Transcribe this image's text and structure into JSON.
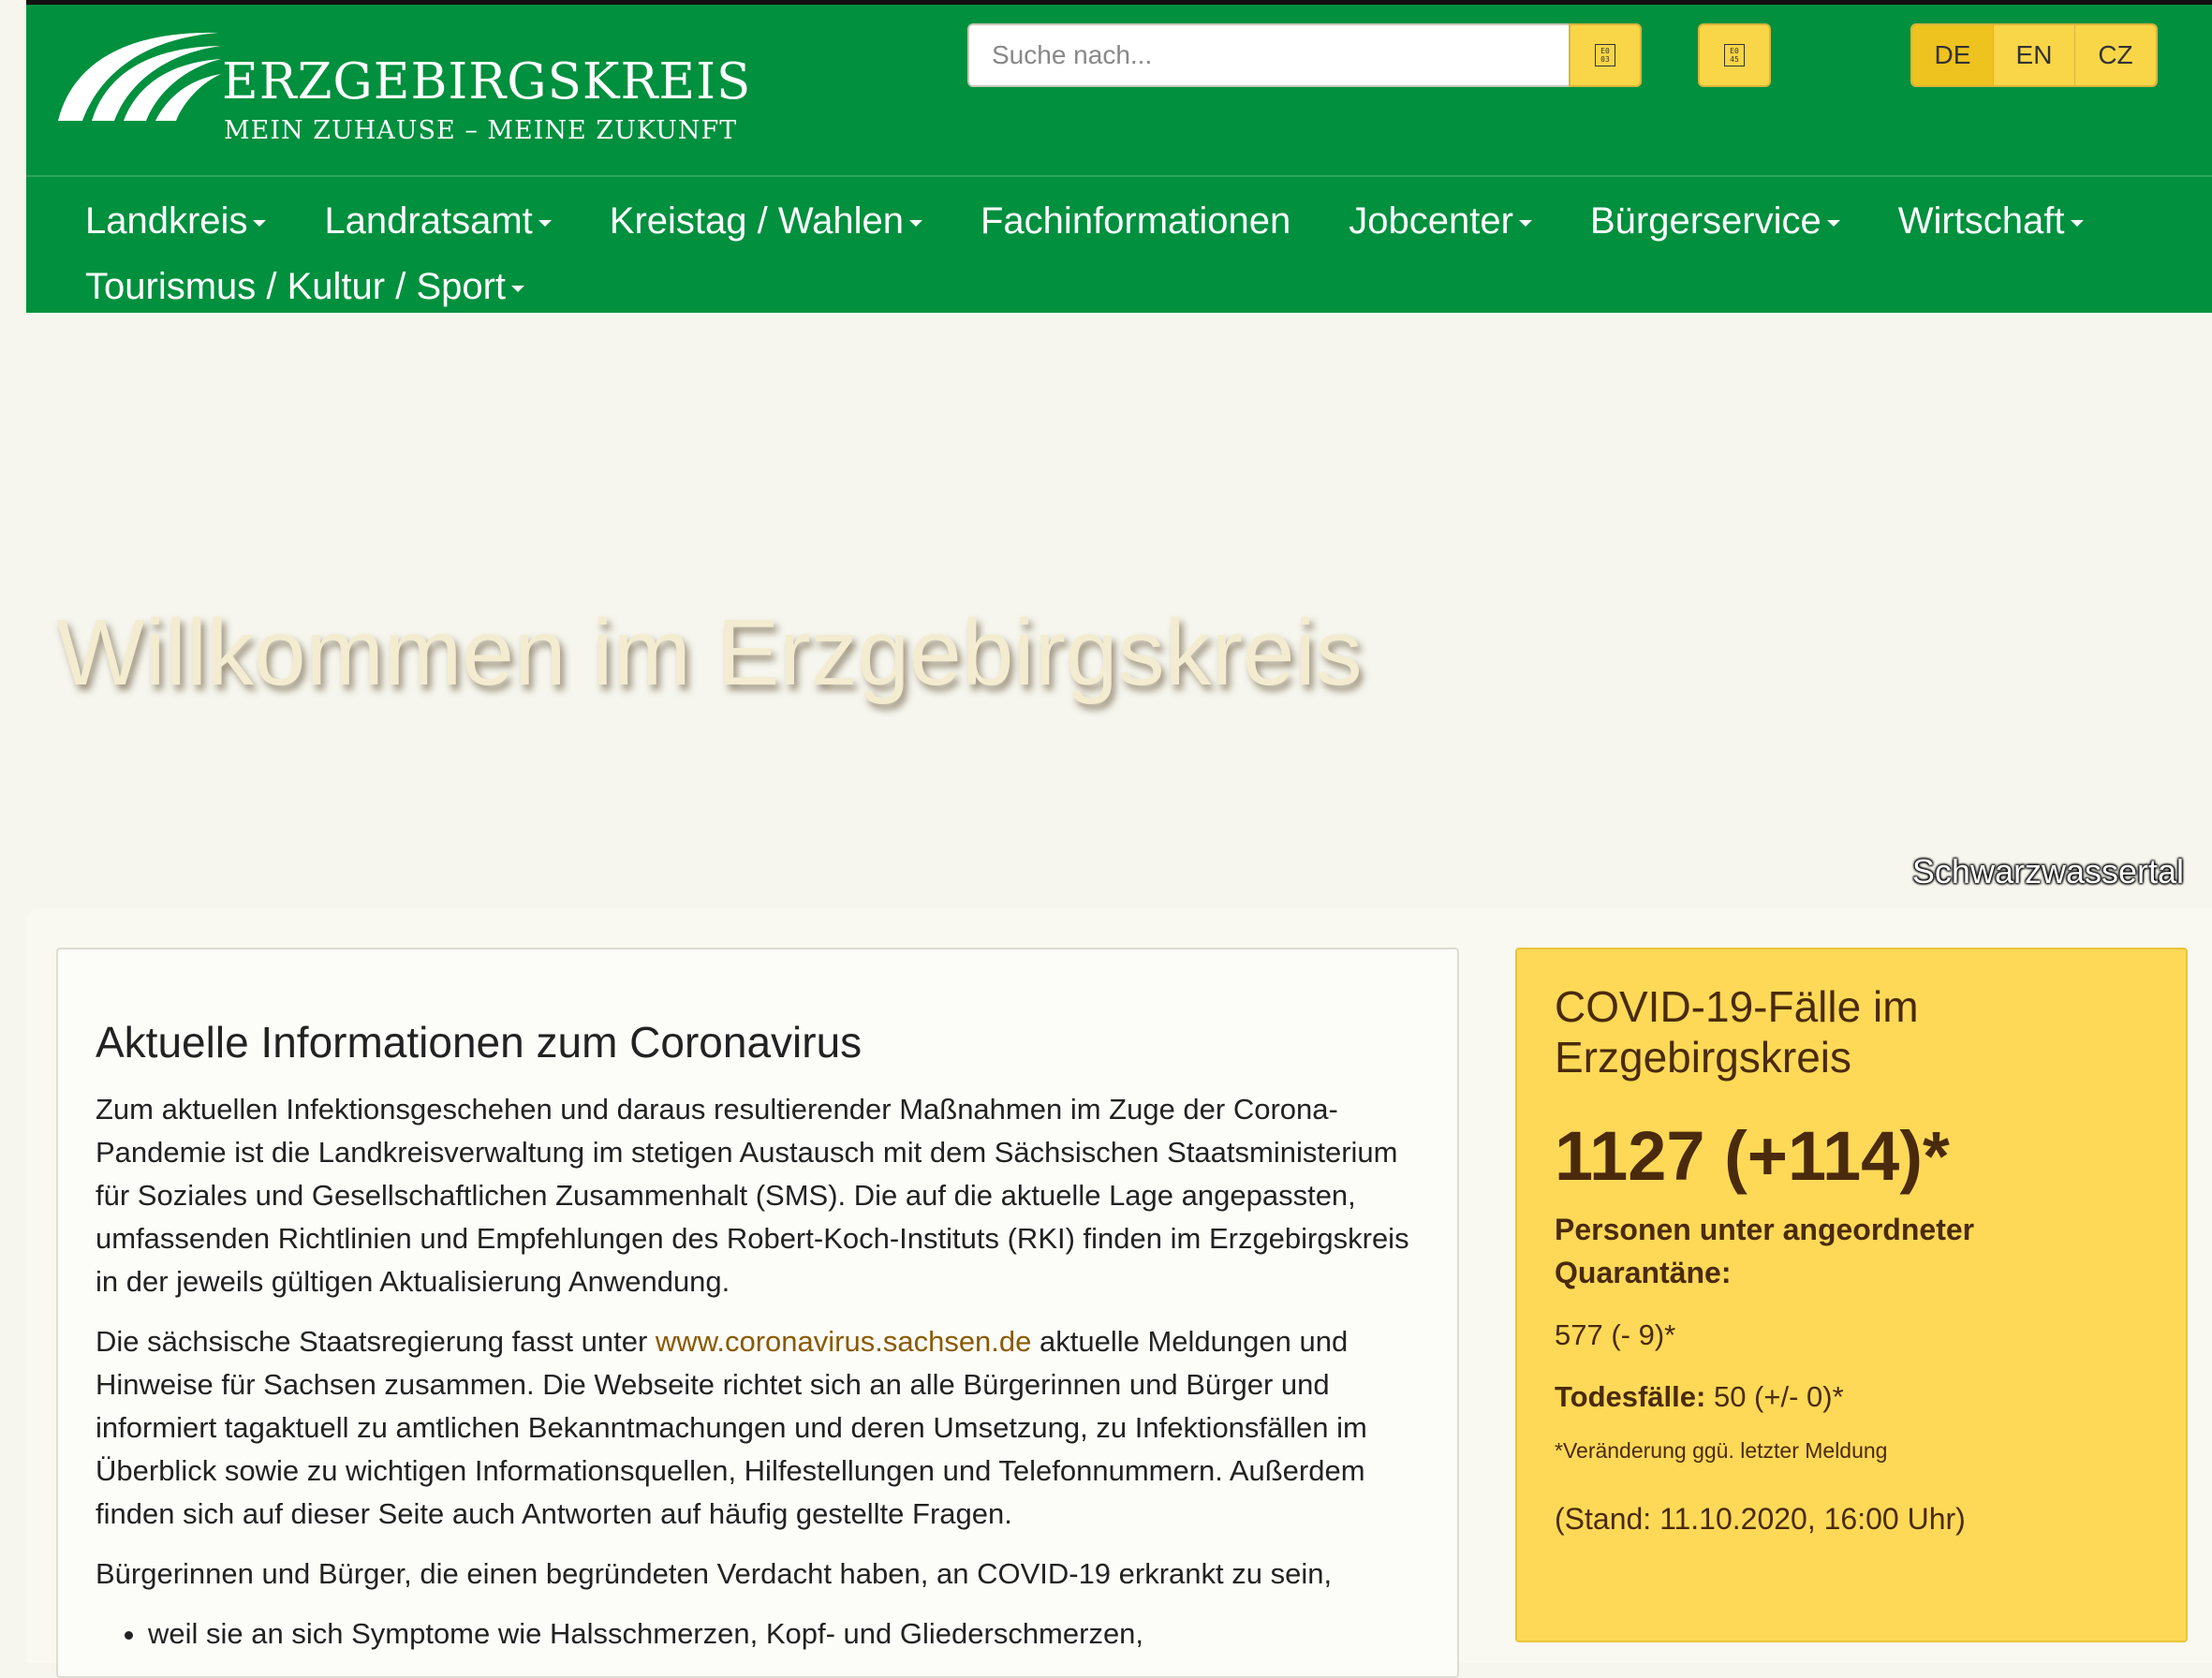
{
  "header": {
    "logo_title": "ERZGEBIRGSKREIS",
    "logo_subtitle": "MEIN ZUHAUSE – MEINE ZUKUNFT",
    "search": {
      "placeholder": "Suche nach..."
    },
    "search_button_glyph": "E0\n03",
    "extra_button_glyph": "E0\n45",
    "languages": [
      "DE",
      "EN",
      "CZ"
    ],
    "active_language": "DE"
  },
  "nav": {
    "items": [
      {
        "label": "Landkreis",
        "dropdown": true
      },
      {
        "label": "Landratsamt",
        "dropdown": true
      },
      {
        "label": "Kreistag / Wahlen",
        "dropdown": true
      },
      {
        "label": "Fachinformationen",
        "dropdown": false
      },
      {
        "label": "Jobcenter",
        "dropdown": true
      },
      {
        "label": "Bürgerservice",
        "dropdown": true
      },
      {
        "label": "Wirtschaft",
        "dropdown": true
      },
      {
        "label": "Tourismus / Kultur / Sport",
        "dropdown": true
      }
    ]
  },
  "hero": {
    "title": "Willkommen im Erzgebirgskreis",
    "caption": "Schwarzwassertal"
  },
  "article": {
    "heading": "Aktuelle Informationen zum Coronavirus",
    "p1": "Zum aktuellen Infektionsgeschehen und daraus resultierender Maßnahmen im Zuge der Corona-Pandemie ist die Landkreisverwaltung im stetigen Austausch mit dem Sächsischen Staatsministerium für Soziales und Gesellschaftlichen Zusammenhalt (SMS). Die auf die aktuelle Lage angepassten, umfassenden Richtlinien und Empfehlungen des Robert-Koch-Instituts (RKI) finden im Erzgebirgskreis in der jeweils gültigen Aktualisierung Anwendung.",
    "p2_before": "Die sächsische Staatsregierung fasst unter ",
    "p2_link": "www.coronavirus.sachsen.de",
    "p2_after": " aktuelle Meldungen und Hinweise für Sachsen zusammen. Die Webseite richtet sich an alle Bürgerinnen und Bürger und informiert tagaktuell zu amtlichen Bekanntmachungen und deren Umsetzung, zu Infektionsfällen im Überblick sowie zu wichtigen Informationsquellen, Hilfestellungen und Telefonnummern. Außerdem finden sich auf dieser Seite auch Antworten auf häufig gestellte Fragen.",
    "p3": "Bürgerinnen und Bürger, die einen begründeten Verdacht haben, an COVID-19 erkrankt zu sein,",
    "list": [
      "weil sie an sich Symptome wie Halsschmerzen, Kopf- und Gliederschmerzen,"
    ]
  },
  "covid": {
    "title": "COVID-19-Fälle im Erzgebirgskreis",
    "count": "1127 (+114)*",
    "quarantine_label": "Personen unter angeordneter Quarantäne:",
    "quarantine_value": "577 (- 9)*",
    "deaths_label": "Todesfälle:",
    "deaths_value": " 50 (+/- 0)*",
    "note": "*Veränderung ggü. letzter Meldung",
    "stand": "(Stand: 11.10.2020, 16:00 Uhr)"
  },
  "colors": {
    "header_green": "#00903e",
    "accent_yellow": "#f9d648",
    "covid_box": "#fdd957",
    "page_bg": "#f6f6ee"
  }
}
